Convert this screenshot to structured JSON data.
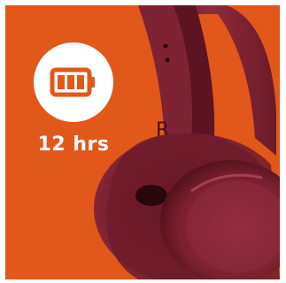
{
  "feature": {
    "battery_life_text": "12 hrs",
    "icon": "battery-full-icon"
  },
  "colors": {
    "background_orange": "#e2571a",
    "badge_white": "#ffffff",
    "icon_orange": "#e2571a",
    "headphone_red": "#7a1f2e",
    "headphone_dark": "#4a0f1a",
    "headphone_highlight": "#b04452"
  },
  "headphones": {
    "side_marking": "R"
  }
}
